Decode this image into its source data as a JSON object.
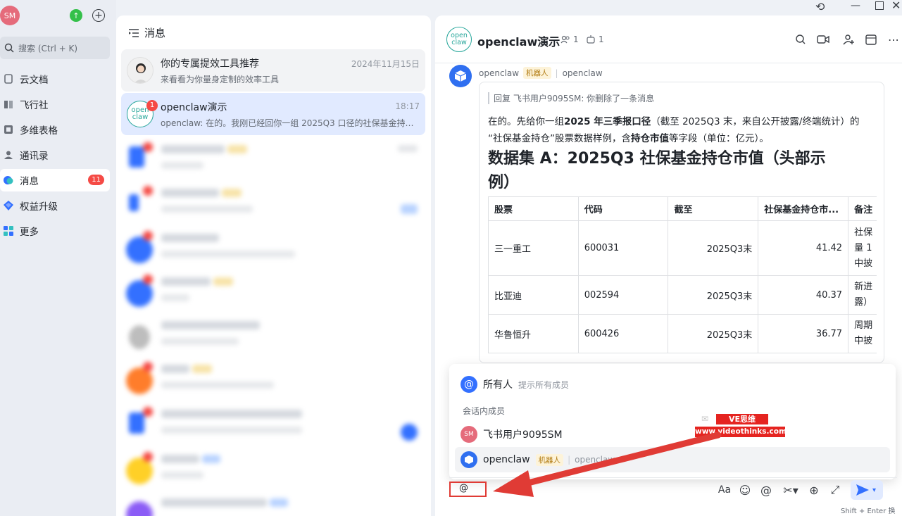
{
  "user": {
    "avatar": "SM"
  },
  "search": {
    "placeholder": "搜索 (Ctrl + K)"
  },
  "nav": {
    "items": [
      {
        "label": "云文档",
        "icon": "docs-icon"
      },
      {
        "label": "飞行社",
        "icon": "book-icon"
      },
      {
        "label": "多维表格",
        "icon": "base-icon"
      },
      {
        "label": "通讯录",
        "icon": "contacts-icon"
      },
      {
        "label": "消息",
        "icon": "message-icon",
        "badge": "11"
      },
      {
        "label": "权益升级",
        "icon": "diamond-icon"
      },
      {
        "label": "更多",
        "icon": "more-apps-icon"
      }
    ]
  },
  "list": {
    "title": "消息",
    "conversations": [
      {
        "name": "你的专属提效工具推荐",
        "time": "2024年11月15日",
        "preview": "来看看为你量身定制的效率工具"
      },
      {
        "name": "openclaw演示",
        "time": "18:17",
        "preview": "openclaw: 在的。我刚已经回你一组 2025Q3 口径的社保基金持仓...",
        "badge": "1",
        "avatar_text": "open claw"
      }
    ]
  },
  "chat": {
    "title": "openclaw演示",
    "members": "1",
    "bots": "1",
    "sender": "openclaw",
    "sender_tag": "机器人",
    "sender_sub": "openclaw",
    "reply_quote": "回复 飞书用户9095SM: 你删除了一条消息",
    "intro_a": "在的。先给你一组",
    "intro_b": "2025 年三季报口径",
    "intro_c": "（截至 2025Q3 末，来自公开披露/终端统计）的",
    "intro_d": "“社保基金持仓”股票数据样例，含",
    "intro_e": "持仓市值",
    "intro_f": "等字段（单位：亿元）。",
    "heading_line1": "数据集 A：2025Q3 社保基金持仓市值（头部示",
    "heading_line2": "例）",
    "table": {
      "headers": [
        "股票",
        "代码",
        "截至",
        "社保基金持仓市...",
        "备注"
      ],
      "rows": [
        {
          "cells": [
            "三一重工",
            "600031",
            "2025Q3末",
            "41.42"
          ],
          "note": [
            "社保",
            "量 1",
            "中披"
          ]
        },
        {
          "cells": [
            "比亚迪",
            "002594",
            "2025Q3末",
            "40.37"
          ],
          "note": [
            "新进",
            "露）"
          ]
        },
        {
          "cells": [
            "华鲁恒升",
            "600426",
            "2025Q3末",
            "36.77"
          ],
          "note": [
            "周期",
            "中披"
          ]
        }
      ]
    }
  },
  "mention": {
    "all_label": "所有人",
    "all_hint": "提示所有成员",
    "section_label": "会话内成员",
    "members": [
      {
        "name": "飞书用户9095SM",
        "avatar": "SM"
      },
      {
        "name": "openclaw",
        "tag": "机器人",
        "sub": "openclaw"
      }
    ]
  },
  "composer": {
    "value": "@",
    "hint": "Shift + Enter 换行"
  },
  "watermark": {
    "title": "VE思维",
    "url": "www.videothinks.com"
  }
}
